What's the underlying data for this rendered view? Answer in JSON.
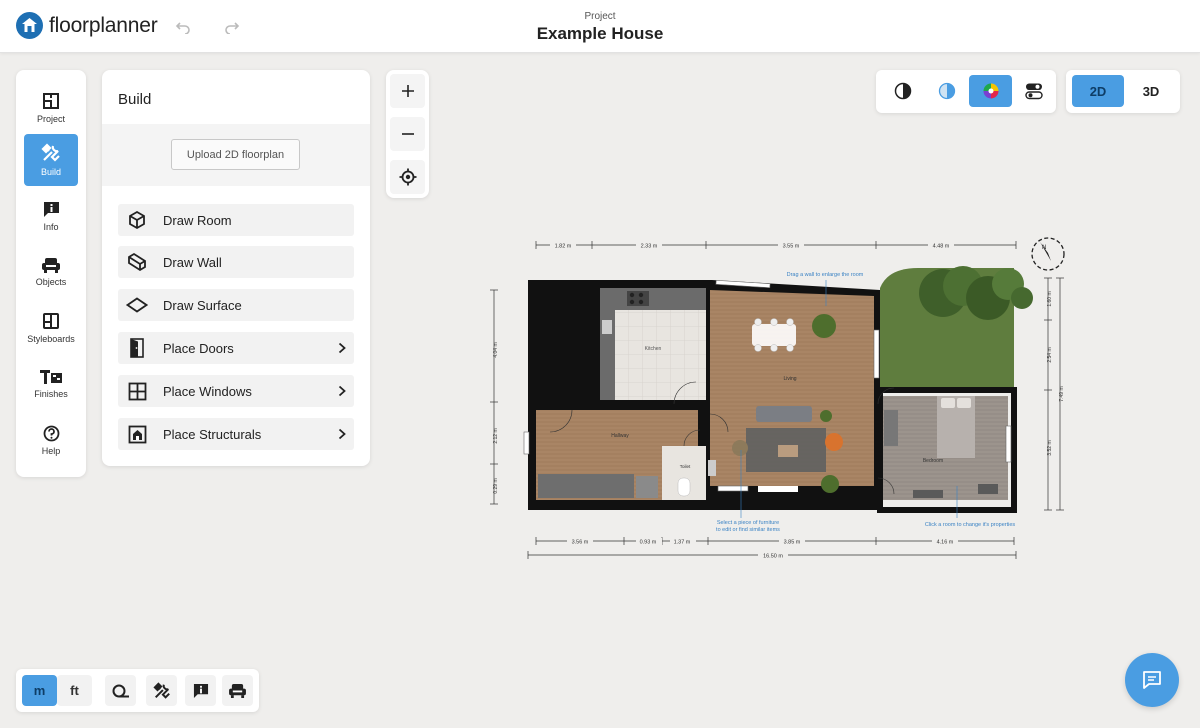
{
  "app": {
    "name": "floorplanner"
  },
  "header": {
    "project_label": "Project",
    "project_name": "Example House"
  },
  "sidebar": {
    "items": [
      {
        "label": "Project",
        "icon": "project-icon"
      },
      {
        "label": "Build",
        "icon": "build-tools-icon",
        "active": true
      },
      {
        "label": "Info",
        "icon": "info-icon"
      },
      {
        "label": "Objects",
        "icon": "sofa-icon"
      },
      {
        "label": "Styleboards",
        "icon": "styleboards-icon"
      },
      {
        "label": "Finishes",
        "icon": "finishes-icon"
      },
      {
        "label": "Help",
        "icon": "help-icon"
      }
    ]
  },
  "build": {
    "title": "Build",
    "upload_label": "Upload 2D floorplan",
    "items": [
      {
        "label": "Draw Room",
        "icon": "cube-icon",
        "has_submenu": false
      },
      {
        "label": "Draw Wall",
        "icon": "wall-icon",
        "has_submenu": false
      },
      {
        "label": "Draw Surface",
        "icon": "surface-icon",
        "has_submenu": false
      },
      {
        "label": "Place Doors",
        "icon": "door-icon",
        "has_submenu": true
      },
      {
        "label": "Place Windows",
        "icon": "window-icon",
        "has_submenu": true
      },
      {
        "label": "Place Structurals",
        "icon": "structural-icon",
        "has_submenu": true
      }
    ]
  },
  "view": {
    "modes": [
      "contrast-icon",
      "half-tone-icon",
      "color-wheel-icon",
      "toggles-icon"
    ],
    "active_mode": "color-wheel-icon",
    "dim_2d": "2D",
    "dim_3d": "3D",
    "active_dim": "2D"
  },
  "units": {
    "metric": "m",
    "imperial": "ft",
    "active": "m"
  },
  "colors": {
    "accent": "#4a9de2",
    "brand": "#1e6fb3",
    "background": "#efeeec"
  },
  "floorplan": {
    "rooms": {
      "kitchen": "Kitchen",
      "living": "Living",
      "hallway": "Hallway",
      "toilet": "Toilet",
      "bedroom": "Bedroom"
    },
    "dims_top": [
      "1.82 m",
      "2.33 m",
      "3.55 m",
      "4.48 m"
    ],
    "dims_bottom": [
      "3.56 m",
      "0.93 m",
      "1.37 m",
      "3.85 m",
      "4.16 m"
    ],
    "dim_total": "16.50 m",
    "dims_left": [
      "4.04 m",
      "2.12 m",
      "0.29 m"
    ],
    "dims_right": [
      "1.60 m",
      "2.54 m",
      "3.52 m",
      "7.49 m"
    ],
    "hints": {
      "wall": "Drag a wall to enlarge the room",
      "furniture_line1": "Select a piece of furniture",
      "furniture_line2": "to edit or find similar items",
      "room": "Click a room to change it's properties"
    }
  }
}
